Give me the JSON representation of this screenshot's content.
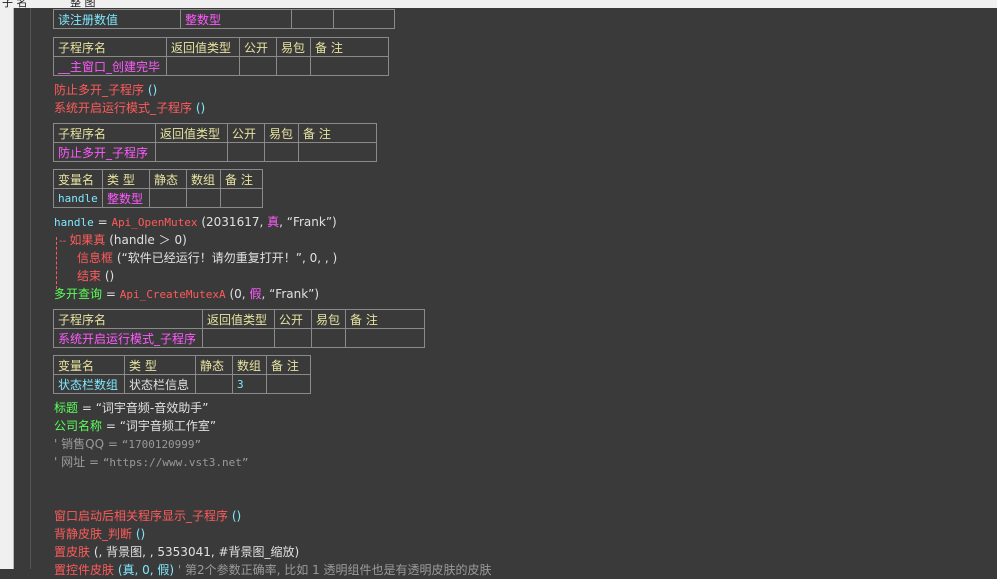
{
  "topbar": {
    "t1": "子 名",
    "t2": "整 图"
  },
  "t0": {
    "c1": "读注册数值",
    "c2": "整数型"
  },
  "t1": {
    "h": [
      "子程序名",
      "返回值类型",
      "公开",
      "易包",
      "备 注"
    ],
    "r": [
      "__主窗口_创建完毕",
      "",
      "",
      "",
      ""
    ]
  },
  "line1": {
    "call": "防止多开_子程序",
    "args": " ()"
  },
  "line2": {
    "call": "系统开启运行模式_子程序",
    "args": " ()"
  },
  "t2": {
    "h": [
      "子程序名",
      "返回值类型",
      "公开",
      "易包",
      "备 注"
    ],
    "r": [
      "防止多开_子程序",
      "",
      "",
      "",
      ""
    ]
  },
  "t3": {
    "h": [
      "变量名",
      "类 型",
      "静态",
      "数组",
      "备 注"
    ],
    "r": [
      "handle",
      "整数型",
      "",
      "",
      ""
    ]
  },
  "l3": {
    "a": "handle",
    "eq": " = ",
    "fn": "Api_OpenMutex",
    "p1": " (2031617, ",
    "p2": "真",
    "p3": ", “Frank”)"
  },
  "l4": {
    "kw": "如果真",
    "args": " (handle ＞ 0)"
  },
  "l5": {
    "kw": "信息框",
    "args": " (“软件已经运行！请勿重复打开！”, 0, , )"
  },
  "l6": {
    "kw": "结束",
    "args": " ()"
  },
  "l7": {
    "a": "多开查询",
    "eq": " = ",
    "fn": "Api_CreateMutexA",
    "p1": " (0, ",
    "p2": "假",
    "p3": ", “Frank”)"
  },
  "t4": {
    "h": [
      "子程序名",
      "返回值类型",
      "公开",
      "易包",
      "备 注"
    ],
    "r": [
      "系统开启运行模式_子程序",
      "",
      "",
      "",
      ""
    ]
  },
  "t5": {
    "h": [
      "变量名",
      "类 型",
      "静态",
      "数组",
      "备 注"
    ],
    "r": [
      "状态栏数组",
      "状态栏信息",
      "",
      "3",
      ""
    ]
  },
  "l8": {
    "a": "标题",
    "eq": " = ",
    "v": "“词宇音频-音效助手”"
  },
  "l9": {
    "a": "公司名称",
    "eq": " = ",
    "v": "“词宇音频工作室”"
  },
  "l10": {
    "q": "' ",
    "a": "销售QQ = ",
    "v": "“1700120999”"
  },
  "l11": {
    "q": "' ",
    "a": "网址 = ",
    "v": "“https://www.vst3.net”"
  },
  "l12": {
    "call": "窗口启动后相关程序显示_子程序",
    "args": " ()"
  },
  "l13": {
    "call": "背静皮肤_判断",
    "args": " ()"
  },
  "l14": {
    "call": "置皮肤",
    "args": " (, 背景图, , 5353041, #背景图_缩放)"
  },
  "l15": {
    "call": "置控件皮肤",
    "a": " (真, 0, 假) ",
    "c": "' 第2个参数正确率, 比如 1 透明组件也是有透明皮肤的皮肤"
  }
}
